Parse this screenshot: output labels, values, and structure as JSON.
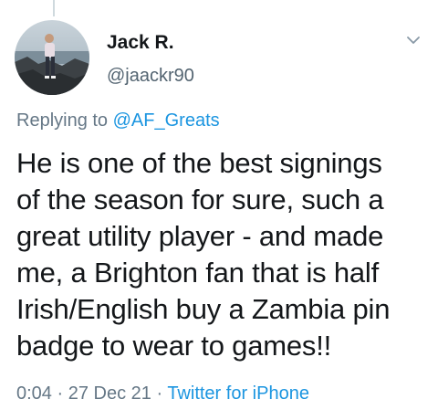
{
  "tweet": {
    "author": {
      "display_name": "Jack R.",
      "handle": "@jaackr90",
      "avatar": "profile-photo"
    },
    "reply": {
      "prefix": "Replying to ",
      "mention": "@AF_Greats"
    },
    "text": "He is one of the best signings\nof the season for sure, such a\ngreat utility player - and made\nme, a Brighton fan that is half\nIrish/English buy a Zambia pin\nbadge to wear to games!!",
    "meta": {
      "time": "0:04",
      "separator1": " · ",
      "date": "27 Dec 21",
      "separator2": " · ",
      "source": "Twitter for iPhone"
    },
    "icons": {
      "menu": "chevron-down-icon"
    },
    "colors": {
      "link": "#1b95e0",
      "secondary_text": "#657786",
      "primary_text": "#14171a"
    }
  }
}
